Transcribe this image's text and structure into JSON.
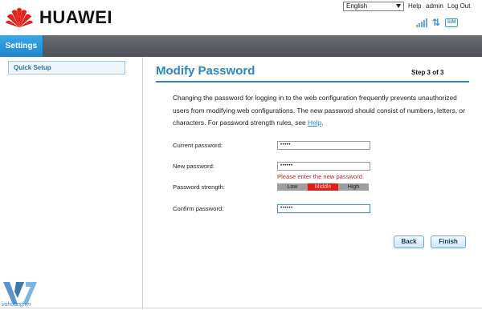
{
  "header": {
    "brand": "HUAWEI",
    "language": "English",
    "links": {
      "help": "Help",
      "admin": "admin",
      "logout": "Log Out"
    },
    "sim_badge": "SIM"
  },
  "nav": {
    "active_tab": "Settings"
  },
  "sidebar": {
    "items": [
      {
        "label": "Quick Setup"
      }
    ]
  },
  "main": {
    "title": "Modify Password",
    "step": "Step 3 of 3",
    "description_main": "Changing the password for logging in to the web configuration frequently prevents unauthorized users from modifying web configurations. The new password should consist of numbers, letters, or characters. For password strength rules, see ",
    "description_link": "Help",
    "description_end": ".",
    "form": {
      "current_label": "Current password:",
      "current_value": "•••••",
      "new_label": "New password:",
      "new_value": "••••••",
      "new_error": "Please enter the new password.",
      "strength_label": "Password strength:",
      "strength": {
        "low": "Low",
        "middle": "Middle",
        "high": "High",
        "active": "Middle"
      },
      "confirm_label": "Confirm password:",
      "confirm_value": "••••••"
    },
    "buttons": {
      "back": "Back",
      "finish": "Finish"
    }
  },
  "watermark": {
    "text": "vohoang.vn"
  },
  "colors": {
    "accent": "#2b86c6",
    "nav_active": "#1d86cc",
    "error": "#c0251e",
    "strength_active": "#e21a1a"
  }
}
